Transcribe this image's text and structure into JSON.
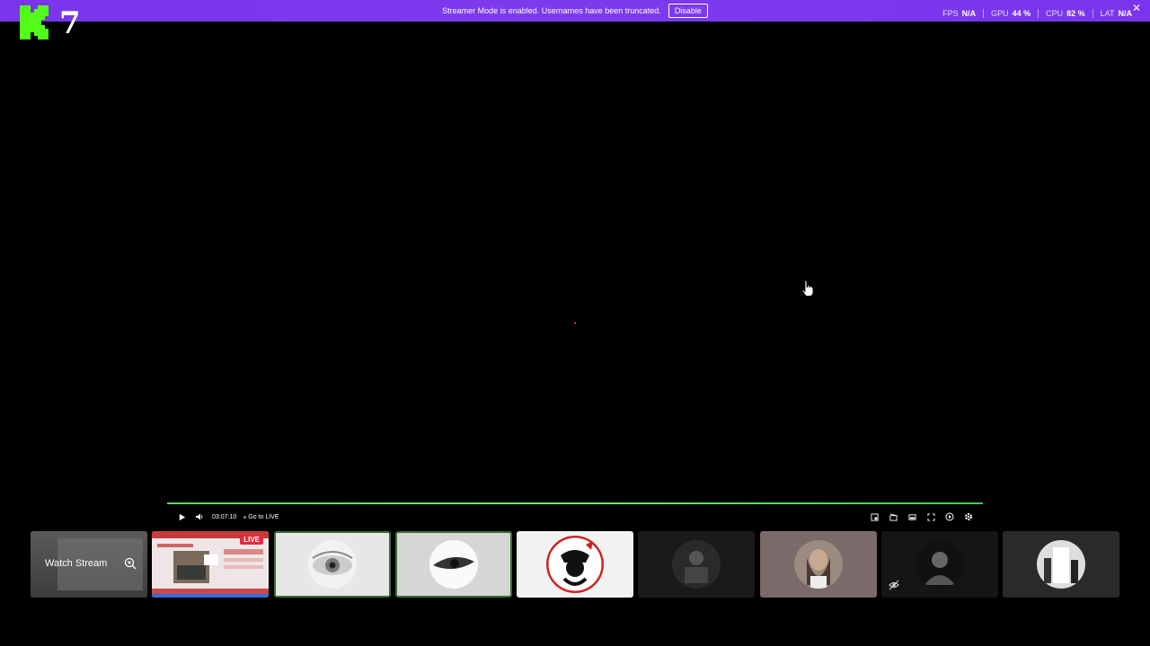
{
  "banner": {
    "message": "Streamer Mode is enabled. Usernames have been truncated.",
    "disable_label": "Disable",
    "close_icon": "close-icon",
    "stats": [
      {
        "label": "FPS",
        "value": "N/A"
      },
      {
        "label": "GPU",
        "value": "44 %"
      },
      {
        "label": "CPU",
        "value": "82 %"
      },
      {
        "label": "LAT",
        "value": "N/A"
      }
    ],
    "color": "#7c3aed"
  },
  "logo": {
    "number": "7",
    "color": "#53fc18"
  },
  "player": {
    "time": "03:07:10",
    "go_live_label": "Go to LIVE",
    "progress_color": "#5fd66b",
    "icons_left": [
      "play-icon",
      "volume-icon"
    ],
    "icons_right": [
      "miniplayer-icon",
      "clip-icon",
      "theater-mode-icon",
      "fullscreen-icon",
      "speed-icon",
      "settings-icon"
    ]
  },
  "thumbnails": {
    "watch_stream_label": "Watch Stream",
    "live_badge": "LIVE",
    "live_color": "#e02b40"
  }
}
